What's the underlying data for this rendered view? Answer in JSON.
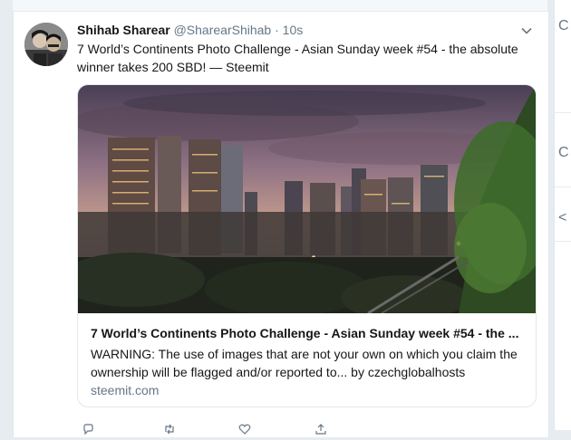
{
  "tweet": {
    "author_name": "Shihab Sharear",
    "handle": "@SharearShihab",
    "separator": "·",
    "time": "10s",
    "text": "7 World’s Continents Photo Challenge - Asian Sunday week #54 - the absolute winner takes 200 SBD! — Steemit"
  },
  "link_card": {
    "title": "7 World’s Continents Photo Challenge - Asian Sunday week #54 - the ...",
    "description": "WARNING: The use of images that are not your own on which you claim the ownership will be flagged and/or reported to... by czechglobalhosts",
    "domain": "steemit.com"
  },
  "right_panel": {
    "fragments": [
      "C",
      "C",
      "<"
    ]
  },
  "colors": {
    "link_blue": "#1da1f2",
    "secondary_text": "#657786",
    "border": "#e1e8ed",
    "page_background": "#e6ecf0"
  },
  "icons": [
    "chevron-down-icon",
    "reply-icon",
    "retweet-icon",
    "like-icon",
    "share-icon"
  ]
}
